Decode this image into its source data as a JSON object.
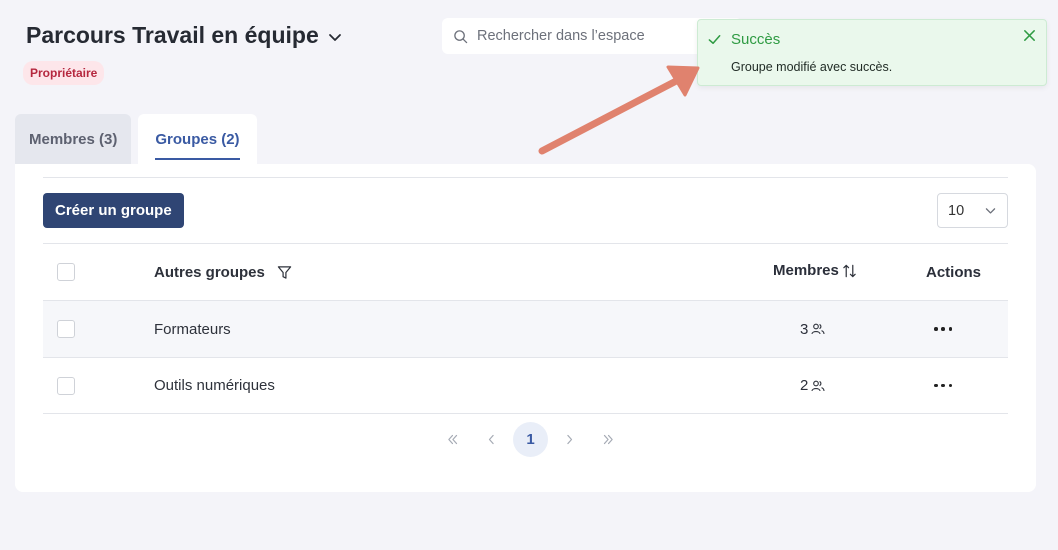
{
  "header": {
    "title": "Parcours Travail en équipe",
    "role_badge": "Propriétaire"
  },
  "search": {
    "placeholder": "Rechercher dans l’espace",
    "value": ""
  },
  "tabs": [
    {
      "label": "Membres (3)",
      "active": false
    },
    {
      "label": "Groupes (2)",
      "active": true
    }
  ],
  "toolbar": {
    "create_label": "Créer un groupe",
    "page_size": "10"
  },
  "table": {
    "columns": {
      "name": "Autres groupes",
      "members": "Membres",
      "actions": "Actions"
    },
    "rows": [
      {
        "name": "Formateurs",
        "members": "3"
      },
      {
        "name": "Outils numériques",
        "members": "2"
      }
    ]
  },
  "pagination": {
    "current_page": "1"
  },
  "toast": {
    "title": "Succès",
    "message": "Groupe modifié avec succès."
  },
  "colors": {
    "primary": "#2f4574",
    "accent": "#3a5aa3",
    "success": "#2f9b43",
    "badge_bg": "#fde6ea",
    "badge_text": "#b5283f",
    "annotation_arrow": "#e0826e"
  },
  "icons": {
    "title_dropdown": "chevron-down-icon",
    "search": "search-icon",
    "filter": "filter-icon",
    "sort": "sort-icon",
    "member": "users-icon",
    "actions": "more-horizontal-icon",
    "toast_status": "check-icon",
    "toast_close": "close-icon"
  }
}
